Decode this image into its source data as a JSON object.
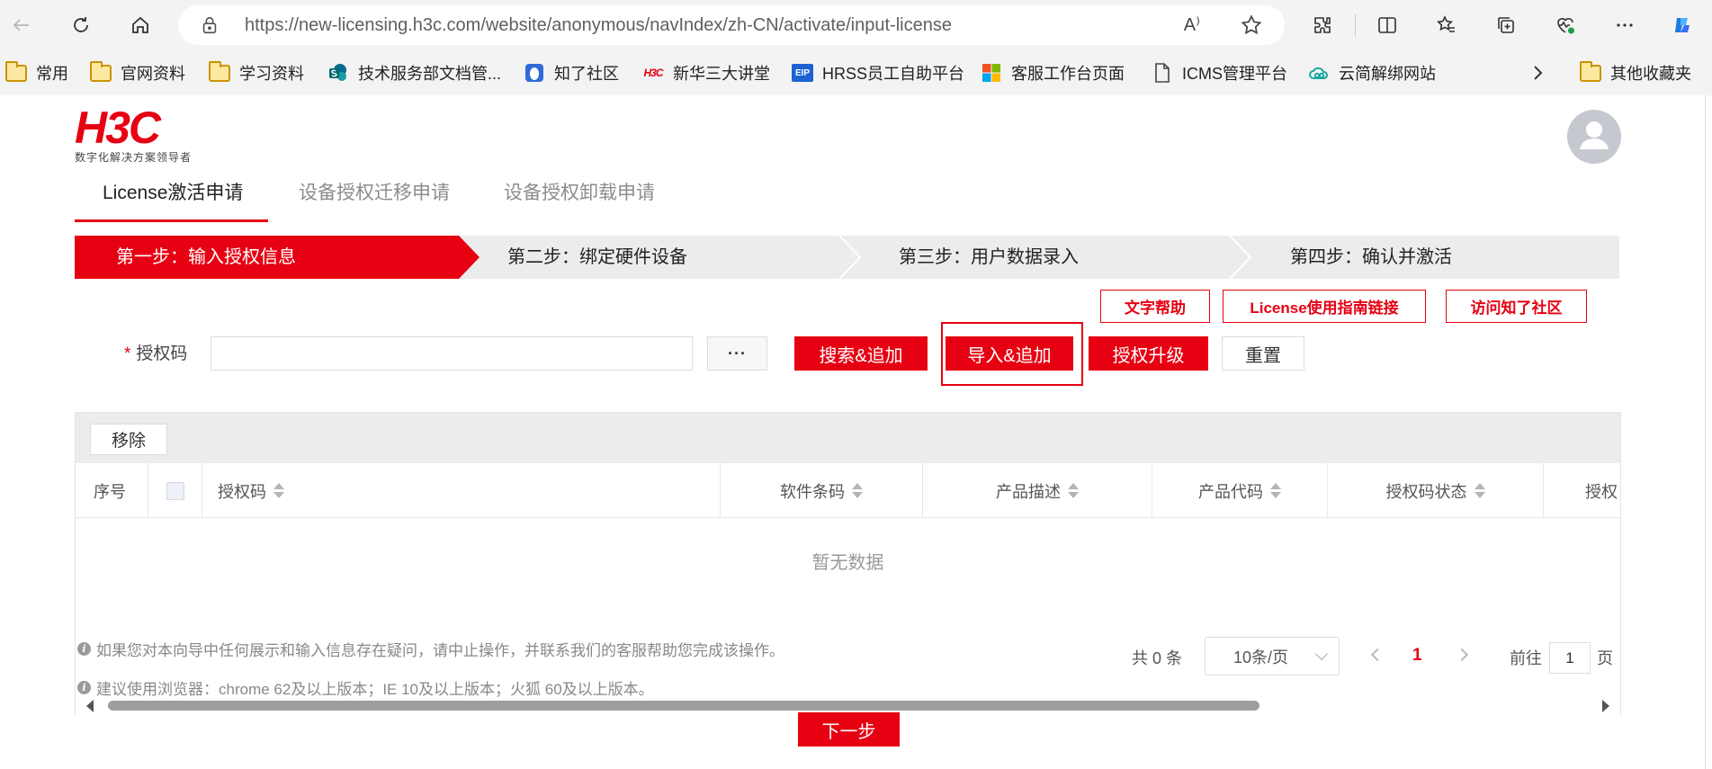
{
  "browser": {
    "url": "https://new-licensing.h3c.com/website/anonymous/navIndex/zh-CN/activate/input-license",
    "read_aloud": "A⁾",
    "bookmarks": [
      {
        "label": "常用",
        "icon": "folder-icon"
      },
      {
        "label": "官网资料",
        "icon": "folder-icon"
      },
      {
        "label": "学习资料",
        "icon": "folder-icon"
      },
      {
        "label": "技术服务部文档管...",
        "icon": "sharepoint-icon"
      },
      {
        "label": "知了社区",
        "icon": "zhiliao-icon"
      },
      {
        "label": "新华三大讲堂",
        "icon": "h3c-icon"
      },
      {
        "label": "HRSS员工自助平台",
        "icon": "eip-icon"
      },
      {
        "label": "客服工作台页面",
        "icon": "microsoft-icon"
      },
      {
        "label": "ICMS管理平台",
        "icon": "page-icon"
      },
      {
        "label": "云简解绑网站",
        "icon": "cloud-icon"
      }
    ],
    "other_bookmarks": "其他收藏夹",
    "h3c_mini": "H3C",
    "eip_mini": "EIP"
  },
  "brand": {
    "logo": "H3C",
    "slogan": "数字化解决方案领导者",
    "accent_color": "#e60012"
  },
  "tabs": [
    "License激活申请",
    "设备授权迁移申请",
    "设备授权卸载申请"
  ],
  "steps": [
    "第一步：输入授权信息",
    "第二步：绑定硬件设备",
    "第三步：用户数据录入",
    "第四步：确认并激活"
  ],
  "help_links": [
    "文字帮助",
    "License使用指南链接",
    "访问知了社区"
  ],
  "form": {
    "required_mark": "*",
    "label": "授权码",
    "value": "",
    "more_button": "···",
    "buttons": [
      "搜索&追加",
      "导入&追加",
      "授权升级"
    ],
    "reset": "重置"
  },
  "table": {
    "remove": "移除",
    "columns": [
      "序号",
      "授权码",
      "软件条码",
      "产品描述",
      "产品代码",
      "授权码状态",
      "授权"
    ],
    "empty": "暂无数据"
  },
  "notes": [
    "如果您对本向导中任何展示和输入信息存在疑问，请中止操作，并联系我们的客服帮助您完成该操作。",
    "建议使用浏览器：chrome 62及以上版本；IE 10及以上版本；火狐 60及以上版本。"
  ],
  "info_glyph": "i",
  "pagination": {
    "total": "共 0 条",
    "page_size": "10条/页",
    "current_page": "1",
    "goto_prefix": "前往",
    "goto_value": "1",
    "goto_suffix": "页"
  },
  "next_step": "下一步"
}
